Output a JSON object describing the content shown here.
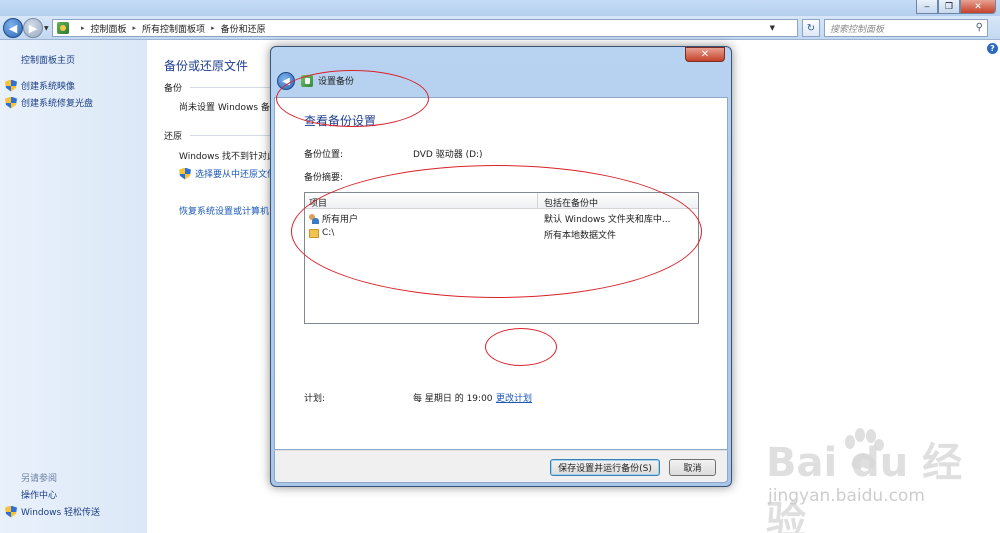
{
  "window": {
    "controls": {
      "minimize": "‒",
      "restore": "❐",
      "close": "✕"
    }
  },
  "address_bar": {
    "crumbs": [
      "控制面板",
      "所有控制面板项",
      "备份和还原"
    ],
    "separator": "▸",
    "search_placeholder": "搜索控制面板"
  },
  "sidebar": {
    "home": "控制面板主页",
    "tasks": [
      "创建系统映像",
      "创建系统修复光盘"
    ],
    "see_also_title": "另请参阅",
    "see_also": [
      "操作中心",
      "Windows 轻松传送"
    ]
  },
  "main": {
    "title": "备份或还原文件",
    "backup_section": "备份",
    "backup_status": "尚未设置 Windows 备份",
    "restore_section": "还原",
    "restore_status": "Windows 找不到针对此",
    "restore_link": "选择要从中还原文件",
    "recover_link": "恢复系统设置或计算机"
  },
  "dialog": {
    "caption": "设置备份",
    "heading": "查看备份设置",
    "location_label": "备份位置:",
    "location_value": "DVD 驱动器 (D:)",
    "summary_label": "备份摘要:",
    "columns": [
      "项目",
      "包括在备份中"
    ],
    "rows": [
      {
        "item": "所有用户",
        "included": "默认 Windows 文件夹和库中..."
      },
      {
        "item": "C:\\",
        "included": "所有本地数据文件"
      }
    ],
    "schedule_label": "计划:",
    "schedule_value": "每 星期日 的 19:00",
    "change_schedule": "更改计划",
    "save_button": "保存设置并运行备份(S)",
    "cancel_button": "取消"
  },
  "watermark": {
    "brand": "Bai  du 经验",
    "url": "jingyan.baidu.com"
  },
  "colors": {
    "link": "#1b58b8",
    "heading": "#1e3f8f",
    "annotation": "#d8232a"
  }
}
